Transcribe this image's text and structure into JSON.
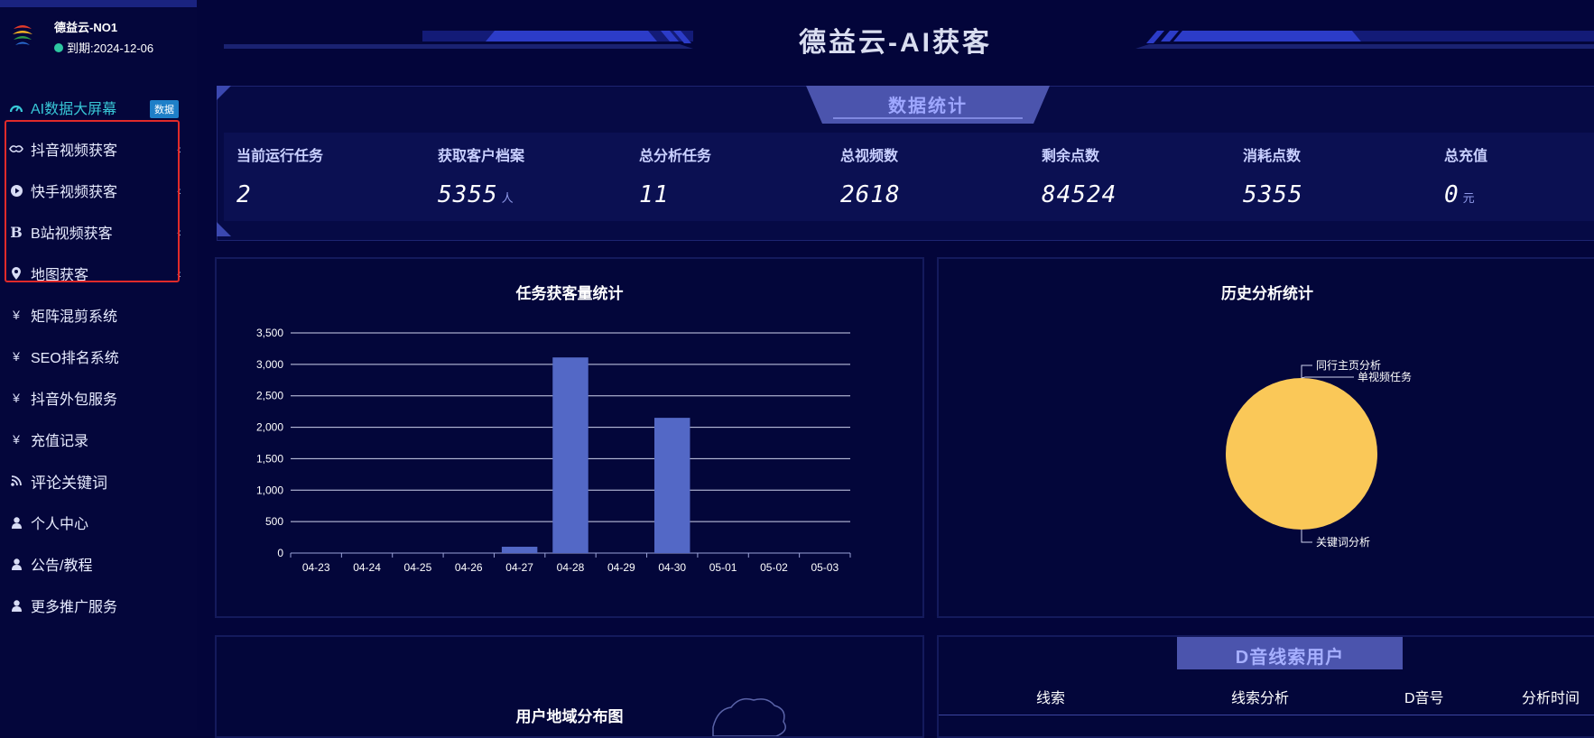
{
  "brand": {
    "name": "德益云-NO1",
    "expiry": "到期:2024-12-06"
  },
  "header": {
    "title": "德益云-AI获客"
  },
  "menu": [
    {
      "label": "AI数据大屏幕",
      "icon": "dashboard-icon",
      "badge": "数据",
      "active": true
    },
    {
      "label": "抖音视频获客",
      "icon": "handshake-icon",
      "chevron": true
    },
    {
      "label": "快手视频获客",
      "icon": "play-circle-icon",
      "chevron": true
    },
    {
      "label": "B站视频获客",
      "icon": "bilibili-b-icon",
      "chevron": true
    },
    {
      "label": "地图获客",
      "icon": "map-pin-icon",
      "chevron": true
    },
    {
      "label": "矩阵混剪系统",
      "icon": "yen-icon"
    },
    {
      "label": "SEO排名系统",
      "icon": "yen-icon"
    },
    {
      "label": "抖音外包服务",
      "icon": "yen-icon"
    },
    {
      "label": "充值记录",
      "icon": "yen-icon"
    },
    {
      "label": "评论关键词",
      "icon": "rss-icon"
    },
    {
      "label": "个人中心",
      "icon": "user-icon"
    },
    {
      "label": "公告/教程",
      "icon": "user-icon"
    },
    {
      "label": "更多推广服务",
      "icon": "user-icon"
    }
  ],
  "stats": {
    "tab": "数据统计",
    "items": [
      {
        "label": "当前运行任务",
        "value": "2",
        "unit": ""
      },
      {
        "label": "获取客户档案",
        "value": "5355",
        "unit": "人"
      },
      {
        "label": "总分析任务",
        "value": "11",
        "unit": ""
      },
      {
        "label": "总视频数",
        "value": "2618",
        "unit": ""
      },
      {
        "label": "剩余点数",
        "value": "84524",
        "unit": ""
      },
      {
        "label": "消耗点数",
        "value": "5355",
        "unit": ""
      },
      {
        "label": "总充值",
        "value": "0",
        "unit": "元"
      }
    ]
  },
  "chart_data": [
    {
      "type": "bar",
      "title": "任务获客量统计",
      "categories": [
        "04-23",
        "04-24",
        "04-25",
        "04-26",
        "04-27",
        "04-28",
        "04-29",
        "04-30",
        "05-01",
        "05-02",
        "05-03"
      ],
      "values": [
        0,
        0,
        0,
        0,
        100,
        3110,
        0,
        2150,
        0,
        0,
        0
      ],
      "ylim": [
        0,
        3500
      ],
      "yticks": [
        "0",
        "500",
        "1,000",
        "1,500",
        "2,000",
        "2,500",
        "3,000",
        "3,500"
      ],
      "color": "#5368c6",
      "grid": true
    },
    {
      "type": "pie",
      "title": "历史分析统计",
      "labels": [
        "同行主页分析",
        "单视频任务",
        "关键词分析"
      ],
      "values": [
        0,
        0,
        11
      ],
      "colors": [
        "#5368c6",
        "#91cc75",
        "#fac858"
      ]
    }
  ],
  "map_panel": {
    "title": "用户地域分布图"
  },
  "leads": {
    "tab": "D音线索用户",
    "columns": [
      "线索",
      "线索分析",
      "D音号",
      "分析时间"
    ]
  }
}
